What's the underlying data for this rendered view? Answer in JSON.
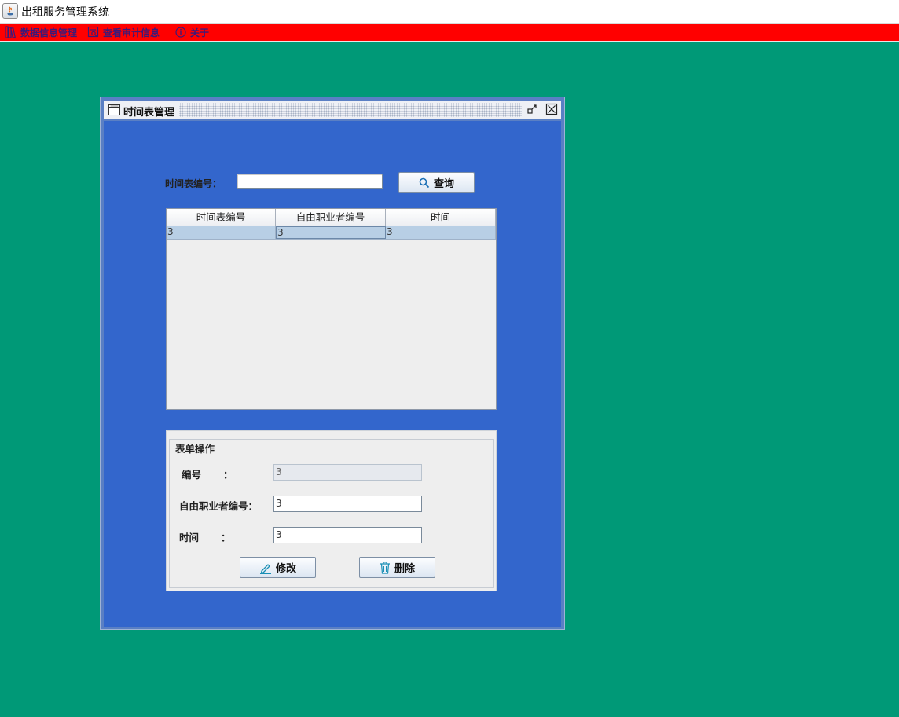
{
  "window": {
    "title": "出租服务管理系统"
  },
  "menu": [
    {
      "label": "数据信息管理",
      "icon": "books-icon"
    },
    {
      "label": "查看审计信息",
      "icon": "audit-icon"
    },
    {
      "label": "关于",
      "icon": "info-icon"
    }
  ],
  "frame": {
    "title": "时间表管理"
  },
  "search": {
    "label": "时间表编号：",
    "value": "",
    "button_label": "查询"
  },
  "table": {
    "columns": [
      "时间表编号",
      "自由职业者编号",
      "时间"
    ],
    "rows": [
      [
        "3",
        "3",
        "3"
      ]
    ]
  },
  "form": {
    "legend": "表单操作",
    "id": {
      "label": "编号",
      "value": "3"
    },
    "freelancer": {
      "label": "自由职业者编号：",
      "value": "3"
    },
    "time": {
      "label": "时间",
      "value": "3"
    },
    "colon": "：",
    "edit_label": "修改",
    "delete_label": "删除"
  },
  "colors": {
    "desktop": "#009977",
    "menubar": "#ff0000",
    "frame_body": "#3366cc"
  }
}
